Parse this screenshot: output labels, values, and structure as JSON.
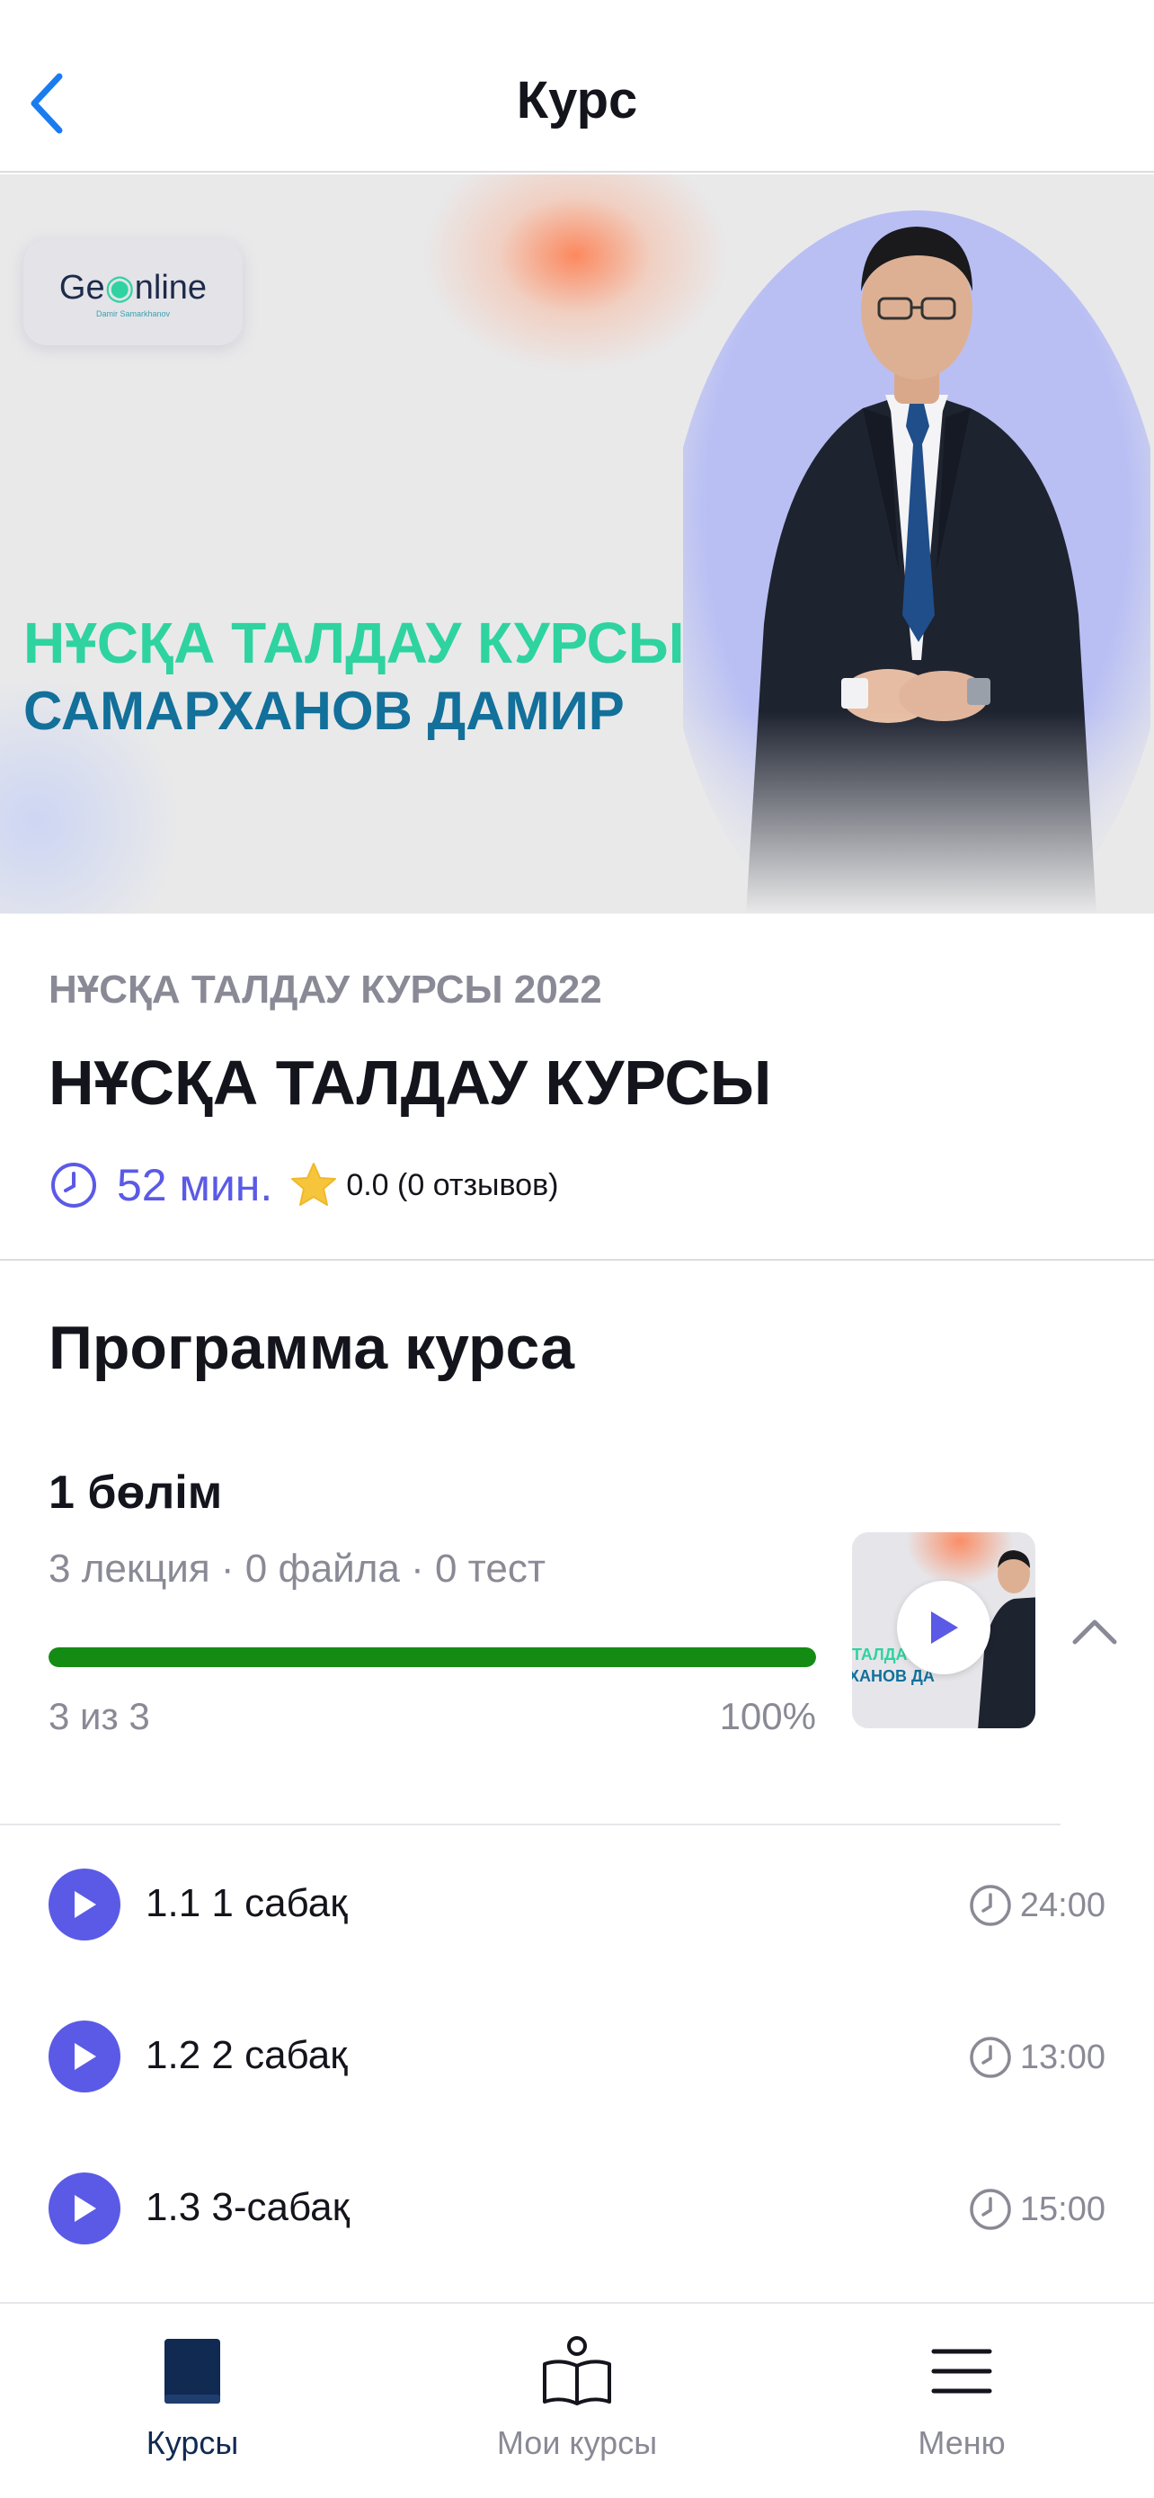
{
  "header": {
    "title": "Курс",
    "back_icon": "chevron-left-icon"
  },
  "banner": {
    "logo_text": "Ge",
    "logo_text2": "nline",
    "logo_sub": "Damir Samarkhanov",
    "line1": "НҰСҚА ТАЛДАУ КУРСЫ",
    "line2": "САМАРХАНОВ ДАМИР",
    "accent_green": "#2ed3a0",
    "accent_blue": "#12709a"
  },
  "course": {
    "subtitle": "НҰСҚА ТАЛДАУ КУРСЫ 2022",
    "title": "НҰСҚА ТАЛДАУ КУРСЫ",
    "duration": "52 мин.",
    "rating": "0.0 (0 отзывов)"
  },
  "program": {
    "title": "Программа курса",
    "section": {
      "title": "1 бөлім",
      "stats": "3 лекция · 0 файла · 0 тест",
      "progress_fraction": 1.0,
      "progress_count": "3 из 3",
      "progress_percent": "100%",
      "thumb_line1": "ТАЛДА",
      "thumb_line2": "ХАНОВ ДА",
      "progress_color": "#148c14"
    },
    "lessons": [
      {
        "title": "1.1 1 сабақ",
        "time": "24:00"
      },
      {
        "title": "1.2 2 сабақ",
        "time": "13:00"
      },
      {
        "title": "1.3 3-сабақ",
        "time": "15:00"
      }
    ]
  },
  "tabbar": {
    "tabs": [
      {
        "label": "Курсы",
        "icon": "book-icon",
        "active": true
      },
      {
        "label": "Мои курсы",
        "icon": "open-book-icon",
        "active": false
      },
      {
        "label": "Меню",
        "icon": "hamburger-menu-icon",
        "active": false
      }
    ]
  },
  "colors": {
    "primary": "#5b5ae6",
    "ios_blue": "#1a7cf0",
    "muted": "#8a8a96"
  }
}
